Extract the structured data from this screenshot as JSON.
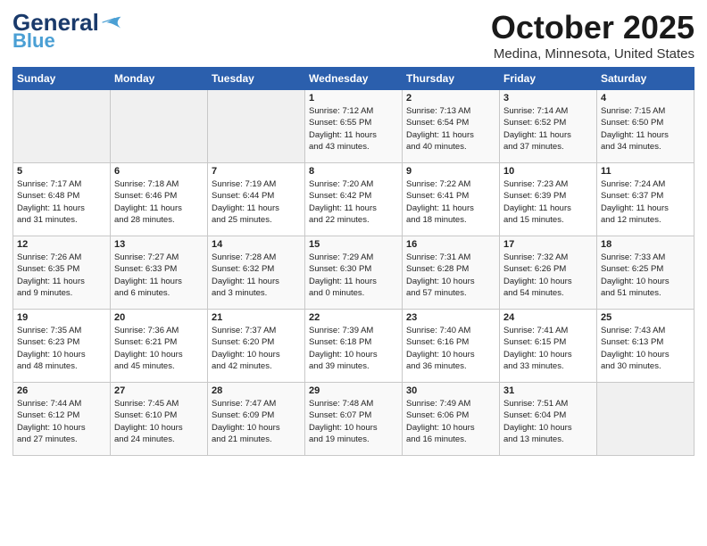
{
  "header": {
    "logo_line1": "General",
    "logo_line2": "Blue",
    "month": "October 2025",
    "location": "Medina, Minnesota, United States"
  },
  "days_of_week": [
    "Sunday",
    "Monday",
    "Tuesday",
    "Wednesday",
    "Thursday",
    "Friday",
    "Saturday"
  ],
  "weeks": [
    [
      {
        "day": "",
        "info": ""
      },
      {
        "day": "",
        "info": ""
      },
      {
        "day": "",
        "info": ""
      },
      {
        "day": "1",
        "info": "Sunrise: 7:12 AM\nSunset: 6:55 PM\nDaylight: 11 hours\nand 43 minutes."
      },
      {
        "day": "2",
        "info": "Sunrise: 7:13 AM\nSunset: 6:54 PM\nDaylight: 11 hours\nand 40 minutes."
      },
      {
        "day": "3",
        "info": "Sunrise: 7:14 AM\nSunset: 6:52 PM\nDaylight: 11 hours\nand 37 minutes."
      },
      {
        "day": "4",
        "info": "Sunrise: 7:15 AM\nSunset: 6:50 PM\nDaylight: 11 hours\nand 34 minutes."
      }
    ],
    [
      {
        "day": "5",
        "info": "Sunrise: 7:17 AM\nSunset: 6:48 PM\nDaylight: 11 hours\nand 31 minutes."
      },
      {
        "day": "6",
        "info": "Sunrise: 7:18 AM\nSunset: 6:46 PM\nDaylight: 11 hours\nand 28 minutes."
      },
      {
        "day": "7",
        "info": "Sunrise: 7:19 AM\nSunset: 6:44 PM\nDaylight: 11 hours\nand 25 minutes."
      },
      {
        "day": "8",
        "info": "Sunrise: 7:20 AM\nSunset: 6:42 PM\nDaylight: 11 hours\nand 22 minutes."
      },
      {
        "day": "9",
        "info": "Sunrise: 7:22 AM\nSunset: 6:41 PM\nDaylight: 11 hours\nand 18 minutes."
      },
      {
        "day": "10",
        "info": "Sunrise: 7:23 AM\nSunset: 6:39 PM\nDaylight: 11 hours\nand 15 minutes."
      },
      {
        "day": "11",
        "info": "Sunrise: 7:24 AM\nSunset: 6:37 PM\nDaylight: 11 hours\nand 12 minutes."
      }
    ],
    [
      {
        "day": "12",
        "info": "Sunrise: 7:26 AM\nSunset: 6:35 PM\nDaylight: 11 hours\nand 9 minutes."
      },
      {
        "day": "13",
        "info": "Sunrise: 7:27 AM\nSunset: 6:33 PM\nDaylight: 11 hours\nand 6 minutes."
      },
      {
        "day": "14",
        "info": "Sunrise: 7:28 AM\nSunset: 6:32 PM\nDaylight: 11 hours\nand 3 minutes."
      },
      {
        "day": "15",
        "info": "Sunrise: 7:29 AM\nSunset: 6:30 PM\nDaylight: 11 hours\nand 0 minutes."
      },
      {
        "day": "16",
        "info": "Sunrise: 7:31 AM\nSunset: 6:28 PM\nDaylight: 10 hours\nand 57 minutes."
      },
      {
        "day": "17",
        "info": "Sunrise: 7:32 AM\nSunset: 6:26 PM\nDaylight: 10 hours\nand 54 minutes."
      },
      {
        "day": "18",
        "info": "Sunrise: 7:33 AM\nSunset: 6:25 PM\nDaylight: 10 hours\nand 51 minutes."
      }
    ],
    [
      {
        "day": "19",
        "info": "Sunrise: 7:35 AM\nSunset: 6:23 PM\nDaylight: 10 hours\nand 48 minutes."
      },
      {
        "day": "20",
        "info": "Sunrise: 7:36 AM\nSunset: 6:21 PM\nDaylight: 10 hours\nand 45 minutes."
      },
      {
        "day": "21",
        "info": "Sunrise: 7:37 AM\nSunset: 6:20 PM\nDaylight: 10 hours\nand 42 minutes."
      },
      {
        "day": "22",
        "info": "Sunrise: 7:39 AM\nSunset: 6:18 PM\nDaylight: 10 hours\nand 39 minutes."
      },
      {
        "day": "23",
        "info": "Sunrise: 7:40 AM\nSunset: 6:16 PM\nDaylight: 10 hours\nand 36 minutes."
      },
      {
        "day": "24",
        "info": "Sunrise: 7:41 AM\nSunset: 6:15 PM\nDaylight: 10 hours\nand 33 minutes."
      },
      {
        "day": "25",
        "info": "Sunrise: 7:43 AM\nSunset: 6:13 PM\nDaylight: 10 hours\nand 30 minutes."
      }
    ],
    [
      {
        "day": "26",
        "info": "Sunrise: 7:44 AM\nSunset: 6:12 PM\nDaylight: 10 hours\nand 27 minutes."
      },
      {
        "day": "27",
        "info": "Sunrise: 7:45 AM\nSunset: 6:10 PM\nDaylight: 10 hours\nand 24 minutes."
      },
      {
        "day": "28",
        "info": "Sunrise: 7:47 AM\nSunset: 6:09 PM\nDaylight: 10 hours\nand 21 minutes."
      },
      {
        "day": "29",
        "info": "Sunrise: 7:48 AM\nSunset: 6:07 PM\nDaylight: 10 hours\nand 19 minutes."
      },
      {
        "day": "30",
        "info": "Sunrise: 7:49 AM\nSunset: 6:06 PM\nDaylight: 10 hours\nand 16 minutes."
      },
      {
        "day": "31",
        "info": "Sunrise: 7:51 AM\nSunset: 6:04 PM\nDaylight: 10 hours\nand 13 minutes."
      },
      {
        "day": "",
        "info": ""
      }
    ]
  ]
}
